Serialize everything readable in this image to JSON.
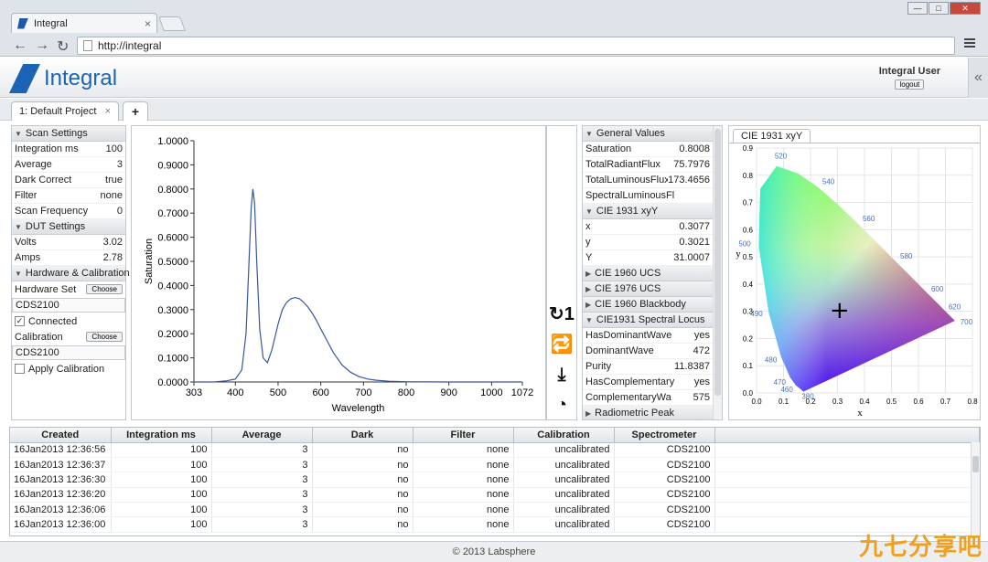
{
  "browser": {
    "tab_title": "Integral",
    "url": "http://integral",
    "win_min": "—",
    "win_max": "□",
    "win_close": "✕"
  },
  "app": {
    "brand": "Integral",
    "user_name": "Integral User",
    "logout_label": "logout",
    "collapse_icon": "«"
  },
  "project_tabs": {
    "active": "1: Default Project",
    "close": "×",
    "add": "+"
  },
  "settings": {
    "scan_header": "Scan Settings",
    "scan_rows": [
      {
        "label": "Integration ms",
        "value": "100"
      },
      {
        "label": "Average",
        "value": "3"
      },
      {
        "label": "Dark Correct",
        "value": "true"
      },
      {
        "label": "Filter",
        "value": "none"
      },
      {
        "label": "Scan Frequency",
        "value": "0"
      }
    ],
    "dut_header": "DUT Settings",
    "dut_rows": [
      {
        "label": "Volts",
        "value": "3.02"
      },
      {
        "label": "Amps",
        "value": "2.78"
      }
    ],
    "hw_header": "Hardware & Calibration",
    "hardware_set_label": "Hardware Set",
    "choose_label": "Choose",
    "hardware_device": "CDS2100",
    "connected_label": "Connected",
    "connected_check": "✓",
    "calibration_label": "Calibration",
    "calibration_device": "CDS2100",
    "apply_calibration_label": "Apply Calibration"
  },
  "chart_data": {
    "type": "line",
    "xlabel": "Wavelength",
    "ylabel": "Saturation",
    "xlim": [
      303,
      1072
    ],
    "ylim": [
      0,
      1
    ],
    "xticks": [
      "303",
      "400",
      "500",
      "600",
      "700",
      "800",
      "900",
      "1000",
      "1072"
    ],
    "yticks": [
      "0.0000",
      "0.1000",
      "0.2000",
      "0.3000",
      "0.4000",
      "0.5000",
      "0.6000",
      "0.7000",
      "0.8000",
      "0.9000",
      "1.0000"
    ],
    "color": "#3a55a0",
    "x": [
      303,
      350,
      380,
      400,
      415,
      425,
      432,
      437,
      441,
      445,
      450,
      457,
      465,
      475,
      485,
      492,
      500,
      510,
      520,
      530,
      540,
      550,
      560,
      570,
      580,
      590,
      600,
      615,
      630,
      650,
      670,
      690,
      710,
      730,
      760,
      800,
      900,
      1000,
      1072
    ],
    "y": [
      0.0,
      0.0,
      0.005,
      0.012,
      0.05,
      0.2,
      0.5,
      0.72,
      0.8,
      0.74,
      0.5,
      0.22,
      0.1,
      0.08,
      0.13,
      0.18,
      0.24,
      0.3,
      0.33,
      0.345,
      0.35,
      0.345,
      0.33,
      0.31,
      0.285,
      0.255,
      0.22,
      0.17,
      0.12,
      0.07,
      0.04,
      0.022,
      0.012,
      0.007,
      0.003,
      0.001,
      0.0,
      0.0,
      0.0
    ]
  },
  "actions": [
    {
      "name": "single-scan-icon",
      "glyph": "↻1"
    },
    {
      "name": "continuous-scan-icon",
      "glyph": "🔁"
    },
    {
      "name": "download-icon",
      "glyph": "⤓"
    },
    {
      "name": "dark-scan-icon",
      "glyph": "◔"
    }
  ],
  "values": {
    "general_header": "General Values",
    "general_rows": [
      {
        "label": "Saturation",
        "value": "0.8008"
      },
      {
        "label": "TotalRadiantFlux",
        "value": "75.7976"
      },
      {
        "label": "TotalLuminousFlux",
        "value": "173.4656"
      },
      {
        "label": "SpectralLuminousFl",
        "value": ""
      }
    ],
    "xyY_header": "CIE 1931 xyY",
    "xyY_rows": [
      {
        "label": "x",
        "value": "0.3077"
      },
      {
        "label": "y",
        "value": "0.3021"
      },
      {
        "label": "Y",
        "value": "31.0007"
      }
    ],
    "collapsed_1": "CIE 1960 UCS",
    "collapsed_2": "CIE 1976 UCS",
    "collapsed_3": "CIE 1960 Blackbody",
    "locus_header": "CIE1931 Spectral Locus",
    "locus_rows": [
      {
        "label": "HasDominantWave",
        "value": "yes"
      },
      {
        "label": "DominantWave",
        "value": "472"
      },
      {
        "label": "Purity",
        "value": "11.8387"
      },
      {
        "label": "HasComplementary",
        "value": "yes"
      },
      {
        "label": "ComplementaryWa",
        "value": "575"
      }
    ],
    "collapsed_4": "Radiometric Peak"
  },
  "cie": {
    "tab_label": "CIE 1931 xyY",
    "xlabel": "x",
    "ylabel": "y",
    "xticks": [
      "0.0",
      "0.1",
      "0.2",
      "0.3",
      "0.4",
      "0.5",
      "0.6",
      "0.7",
      "0.8"
    ],
    "yticks": [
      "0.9",
      "0.8",
      "0.7",
      "0.6",
      "0.5",
      "0.4",
      "0.3",
      "0.2",
      "0.1",
      "0.0"
    ],
    "wavelength_labels": [
      "520",
      "540",
      "560",
      "580",
      "600",
      "620",
      "700",
      "500",
      "490",
      "480",
      "470",
      "460",
      "380"
    ],
    "marker_glyph": "+",
    "point": {
      "x": 0.3077,
      "y": 0.3021
    }
  },
  "grid": {
    "columns": [
      "Created",
      "Integration ms",
      "Average",
      "Dark",
      "Filter",
      "Calibration",
      "Spectrometer"
    ],
    "rows": [
      [
        "16Jan2013 12:36:56",
        "100",
        "3",
        "no",
        "none",
        "uncalibrated",
        "CDS2100"
      ],
      [
        "16Jan2013 12:36:37",
        "100",
        "3",
        "no",
        "none",
        "uncalibrated",
        "CDS2100"
      ],
      [
        "16Jan2013 12:36:30",
        "100",
        "3",
        "no",
        "none",
        "uncalibrated",
        "CDS2100"
      ],
      [
        "16Jan2013 12:36:20",
        "100",
        "3",
        "no",
        "none",
        "uncalibrated",
        "CDS2100"
      ],
      [
        "16Jan2013 12:36:06",
        "100",
        "3",
        "no",
        "none",
        "uncalibrated",
        "CDS2100"
      ],
      [
        "16Jan2013 12:36:00",
        "100",
        "3",
        "no",
        "none",
        "uncalibrated",
        "CDS2100"
      ]
    ]
  },
  "footer": {
    "copyright": "© 2013 Labsphere",
    "watermark": "九七分享吧"
  }
}
